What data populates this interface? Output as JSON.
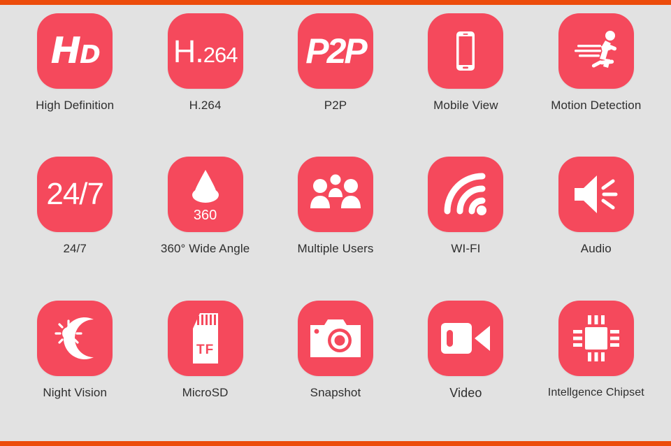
{
  "page": {
    "background_color": "#e2e2e2",
    "accent_bar_color": "#ec4c0b",
    "tile_color": "#f5495c",
    "label_color": "#2e2e2e"
  },
  "features": [
    {
      "icon": "hd-icon",
      "label": "High Definition",
      "glyph_main": "H",
      "glyph_sub": "D"
    },
    {
      "icon": "h264-icon",
      "label": "H.264",
      "glyph_main": "H.",
      "glyph_sub": "264"
    },
    {
      "icon": "p2p-icon",
      "label": "P2P",
      "glyph_main": "P2P"
    },
    {
      "icon": "mobile-phone-icon",
      "label": "Mobile View"
    },
    {
      "icon": "running-person-icon",
      "label": "Motion Detection"
    },
    {
      "icon": "twentyfour-seven-icon",
      "label": "24/7",
      "glyph_main": "24/7"
    },
    {
      "icon": "fisheye-lens-icon",
      "label": "360° Wide Angle",
      "glyph_sub": "360"
    },
    {
      "icon": "users-group-icon",
      "label": "Multiple Users"
    },
    {
      "icon": "wifi-icon",
      "label": "WI-FI"
    },
    {
      "icon": "speaker-icon",
      "label": "Audio"
    },
    {
      "icon": "sun-moon-icon",
      "label": "Night Vision"
    },
    {
      "icon": "sd-card-icon",
      "label": "MicroSD",
      "glyph_sub": "TF"
    },
    {
      "icon": "camera-icon",
      "label": "Snapshot"
    },
    {
      "icon": "camcorder-icon",
      "label": "Video"
    },
    {
      "icon": "chipset-icon",
      "label": "Intellgence Chipset"
    }
  ]
}
